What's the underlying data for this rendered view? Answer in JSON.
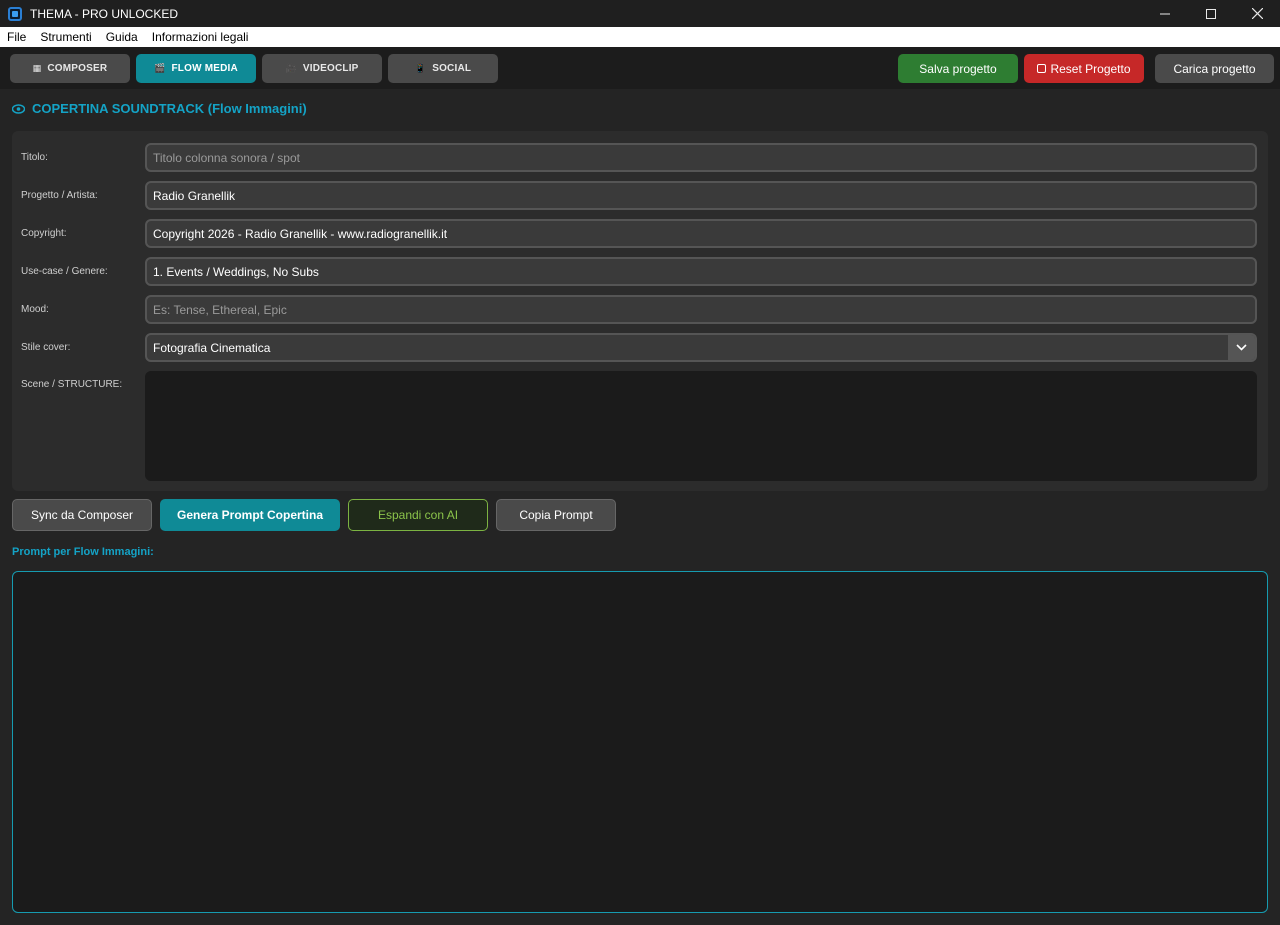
{
  "window": {
    "title": "THEMA - PRO UNLOCKED"
  },
  "menu": [
    "File",
    "Strumenti",
    "Guida",
    "Informazioni legali"
  ],
  "tabs": [
    {
      "icon": "▦",
      "label": "COMPOSER"
    },
    {
      "icon": "🎬",
      "label": "FLOW MEDIA",
      "active": true
    },
    {
      "icon": "🎥",
      "label": "VIDEOCLIP"
    },
    {
      "icon": "📱",
      "label": "SOCIAL"
    }
  ],
  "actions": {
    "save": "Salva progetto",
    "reset": "Reset Progetto",
    "load": "Carica progetto"
  },
  "section": {
    "title": "COPERTINA SOUNDTRACK (Flow Immagini)"
  },
  "form": {
    "titolo": {
      "label": "Titolo:",
      "value": "",
      "placeholder": "Titolo colonna sonora / spot"
    },
    "artista": {
      "label": "Progetto / Artista:",
      "value": "Radio Granellik"
    },
    "copyright": {
      "label": "Copyright:",
      "value": "Copyright 2026 - Radio Granellik  - www.radiogranellik.it"
    },
    "usecase": {
      "label": "Use-case / Genere:",
      "value": "1. Events / Weddings, No Subs"
    },
    "mood": {
      "label": "Mood:",
      "value": "",
      "placeholder": "Es: Tense, Ethereal, Epic"
    },
    "stile": {
      "label": "Stile cover:",
      "value": "Fotografia Cinematica"
    },
    "scene": {
      "label": "Scene / STRUCTURE:",
      "value": ""
    }
  },
  "buttons": {
    "sync": "Sync da Composer",
    "genera": "Genera Prompt Copertina",
    "espandi": "Espandi con AI",
    "copia": "Copia Prompt"
  },
  "output": {
    "label": "Prompt per Flow Immagini:",
    "value": ""
  },
  "colors": {
    "accent": "#0f8a96",
    "title_accent": "#14a3c6",
    "save": "#2e7d32",
    "reset": "#c62828",
    "ai_border": "#7cb342"
  }
}
